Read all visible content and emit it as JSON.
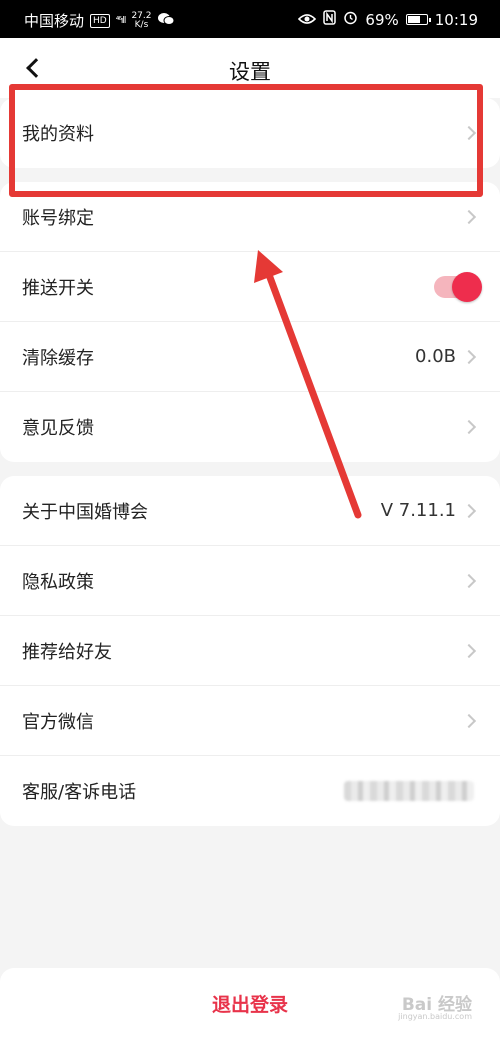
{
  "status_bar": {
    "carrier": "中国移动",
    "hd": "HD",
    "network": "⁴⁶ıll",
    "speed_value": "27.2",
    "speed_unit": "K/s",
    "battery": "69%",
    "time": "10:19",
    "battery_level": 0.69
  },
  "header": {
    "title": "设置"
  },
  "groups": [
    {
      "rows": [
        {
          "label": "我的资料"
        }
      ]
    },
    {
      "rows": [
        {
          "label": "账号绑定"
        },
        {
          "label": "推送开关",
          "toggle_on": true
        },
        {
          "label": "清除缓存",
          "value": "0.0B"
        },
        {
          "label": "意见反馈"
        }
      ]
    },
    {
      "rows": [
        {
          "label": "关于中国婚博会",
          "value": "V 7.11.1"
        },
        {
          "label": "隐私政策"
        },
        {
          "label": "推荐给好友"
        },
        {
          "label": "官方微信"
        },
        {
          "label": "客服/客诉电话"
        }
      ]
    }
  ],
  "logout": {
    "label": "退出登录"
  },
  "watermark": {
    "text": "Bai 经验",
    "sub": "jingyan.baidu.com"
  },
  "colors": {
    "accent": "#ee2d4d",
    "annotation": "#e53935",
    "logout_text": "#e8334a"
  },
  "icons": [
    "back-arrow-icon",
    "chevron-right-icon",
    "wechat-icon",
    "eye-icon",
    "nfc-icon",
    "alarm-icon",
    "battery-icon"
  ]
}
